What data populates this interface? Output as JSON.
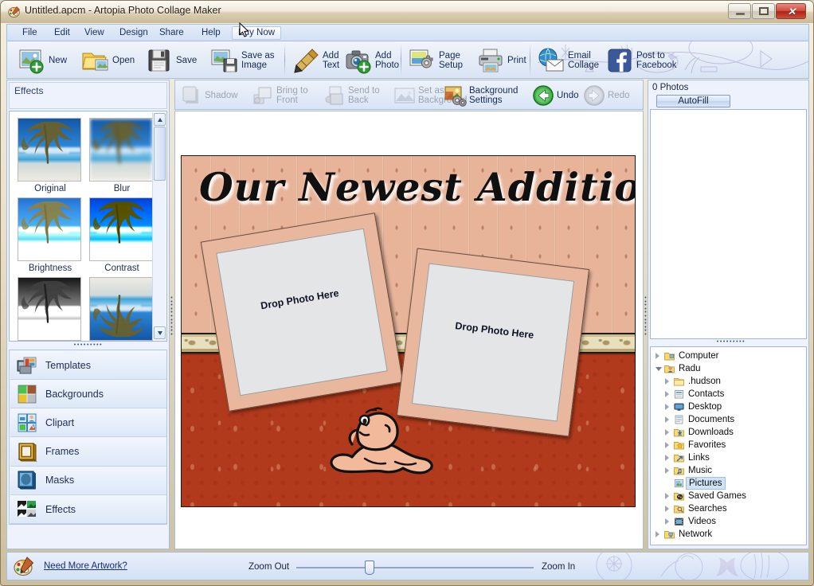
{
  "window": {
    "title": "Untitled.apcm - Artopia Photo Collage Maker",
    "app_icon": "palette-icon",
    "minimize_label": "Minimize",
    "maximize_label": "Maximize",
    "close_label": "Close",
    "close_glyph": "✕"
  },
  "menu": {
    "items": [
      {
        "label": "File",
        "name": "menu-file",
        "hover": false
      },
      {
        "label": "Edit",
        "name": "menu-edit",
        "hover": false
      },
      {
        "label": "View",
        "name": "menu-view",
        "hover": false
      },
      {
        "label": "Design",
        "name": "menu-design",
        "hover": false
      },
      {
        "label": "Share",
        "name": "menu-share",
        "hover": false
      },
      {
        "label": "Help",
        "name": "menu-help",
        "hover": false
      },
      {
        "label": "Buy Now",
        "name": "menu-buy-now",
        "hover": true
      }
    ]
  },
  "toolbar": {
    "buttons": [
      {
        "label": "New",
        "icon": "new-image-icon",
        "name": "new-button"
      },
      {
        "label": "Open",
        "icon": "open-folder-icon",
        "name": "open-button"
      },
      {
        "label": "Save",
        "icon": "floppy-disk-icon",
        "name": "save-button"
      },
      {
        "label": "Save as\nImage",
        "icon": "save-as-image-icon",
        "name": "save-as-image-button"
      },
      {
        "label": "Add\nText",
        "icon": "pen-icon",
        "name": "add-text-button"
      },
      {
        "label": "Add\nPhoto",
        "icon": "camera-plus-icon",
        "name": "add-photo-button"
      },
      {
        "label": "Page\nSetup",
        "icon": "page-setup-icon",
        "name": "page-setup-button"
      },
      {
        "label": "Print",
        "icon": "printer-icon",
        "name": "print-button"
      },
      {
        "label": "Email\nCollage",
        "icon": "email-globe-icon",
        "name": "email-collage-button"
      },
      {
        "label": "Post to\nFacebook",
        "icon": "facebook-icon",
        "name": "post-to-facebook-button"
      }
    ]
  },
  "toolbar2": {
    "buttons": [
      {
        "label": "Shadow",
        "icon": "shadow-icon",
        "name": "shadow-button",
        "enabled": false
      },
      {
        "label": "Bring to\nFront",
        "icon": "bring-to-front-icon",
        "name": "bring-to-front-button",
        "enabled": false
      },
      {
        "label": "Send to\nBack",
        "icon": "send-to-back-icon",
        "name": "send-to-back-button",
        "enabled": false
      },
      {
        "label": "Set as\nBackground",
        "icon": "set-as-background-icon",
        "name": "set-as-background-button",
        "enabled": false
      },
      {
        "label": "Background\nSettings",
        "icon": "background-settings-icon",
        "name": "background-settings-button",
        "enabled": true
      },
      {
        "label": "Undo",
        "icon": "undo-arrow-icon",
        "name": "undo-button",
        "enabled": true
      },
      {
        "label": "Redo",
        "icon": "redo-arrow-icon",
        "name": "redo-button",
        "enabled": false
      }
    ]
  },
  "left_panel": {
    "header": "Effects",
    "effects": [
      {
        "label": "Original",
        "name": "effect-original"
      },
      {
        "label": "Blur",
        "name": "effect-blur"
      },
      {
        "label": "Brightness",
        "name": "effect-brightness"
      },
      {
        "label": "Contrast",
        "name": "effect-contrast"
      },
      {
        "label": "",
        "name": "effect-emboss"
      },
      {
        "label": "",
        "name": "effect-flip"
      }
    ],
    "categories": [
      {
        "label": "Templates",
        "icon": "templates-icon",
        "name": "category-templates"
      },
      {
        "label": "Backgrounds",
        "icon": "backgrounds-icon",
        "name": "category-backgrounds"
      },
      {
        "label": "Clipart",
        "icon": "clipart-icon",
        "name": "category-clipart"
      },
      {
        "label": "Frames",
        "icon": "frames-icon",
        "name": "category-frames"
      },
      {
        "label": "Masks",
        "icon": "masks-icon",
        "name": "category-masks"
      },
      {
        "label": "Effects",
        "icon": "effects-icon",
        "name": "category-effects"
      }
    ]
  },
  "canvas": {
    "collage_title": "Our Newest Addition!",
    "photo_slot_1": "Drop Photo Here",
    "photo_slot_2": "Drop Photo Here",
    "colors": {
      "wallpaper": "#e7b49a",
      "carpet": "#b23a1c",
      "frame": "#e8b79e",
      "slot": "#e4e5e7"
    }
  },
  "right_panel": {
    "photo_count": "0 Photos",
    "autofill_label": "AutoFill",
    "tree": [
      {
        "label": "Computer",
        "indent": 0,
        "icon": "computer-folder-icon",
        "expander": "collapsed",
        "selected": false
      },
      {
        "label": "Radu",
        "indent": 0,
        "icon": "user-folder-icon",
        "expander": "expanded",
        "selected": false
      },
      {
        "label": ".hudson",
        "indent": 1,
        "icon": "folder-icon",
        "expander": "collapsed",
        "selected": false
      },
      {
        "label": "Contacts",
        "indent": 1,
        "icon": "contacts-folder-icon",
        "expander": "collapsed",
        "selected": false
      },
      {
        "label": "Desktop",
        "indent": 1,
        "icon": "desktop-folder-icon",
        "expander": "collapsed",
        "selected": false
      },
      {
        "label": "Documents",
        "indent": 1,
        "icon": "documents-folder-icon",
        "expander": "collapsed",
        "selected": false
      },
      {
        "label": "Downloads",
        "indent": 1,
        "icon": "downloads-folder-icon",
        "expander": "collapsed",
        "selected": false
      },
      {
        "label": "Favorites",
        "indent": 1,
        "icon": "favorites-folder-icon",
        "expander": "collapsed",
        "selected": false
      },
      {
        "label": "Links",
        "indent": 1,
        "icon": "links-folder-icon",
        "expander": "collapsed",
        "selected": false
      },
      {
        "label": "Music",
        "indent": 1,
        "icon": "music-folder-icon",
        "expander": "collapsed",
        "selected": false
      },
      {
        "label": "Pictures",
        "indent": 1,
        "icon": "pictures-folder-icon",
        "expander": "none",
        "selected": true
      },
      {
        "label": "Saved Games",
        "indent": 1,
        "icon": "saved-games-folder-icon",
        "expander": "collapsed",
        "selected": false
      },
      {
        "label": "Searches",
        "indent": 1,
        "icon": "searches-folder-icon",
        "expander": "collapsed",
        "selected": false
      },
      {
        "label": "Videos",
        "indent": 1,
        "icon": "videos-folder-icon",
        "expander": "collapsed",
        "selected": false
      },
      {
        "label": "Network",
        "indent": 0,
        "icon": "network-folder-icon",
        "expander": "collapsed",
        "selected": false
      }
    ]
  },
  "status_bar": {
    "artwork_link": "Need More Artwork?",
    "artwork_icon": "palette-icon",
    "zoom_out_label": "Zoom Out",
    "zoom_in_label": "Zoom In",
    "zoom_value": 30
  }
}
